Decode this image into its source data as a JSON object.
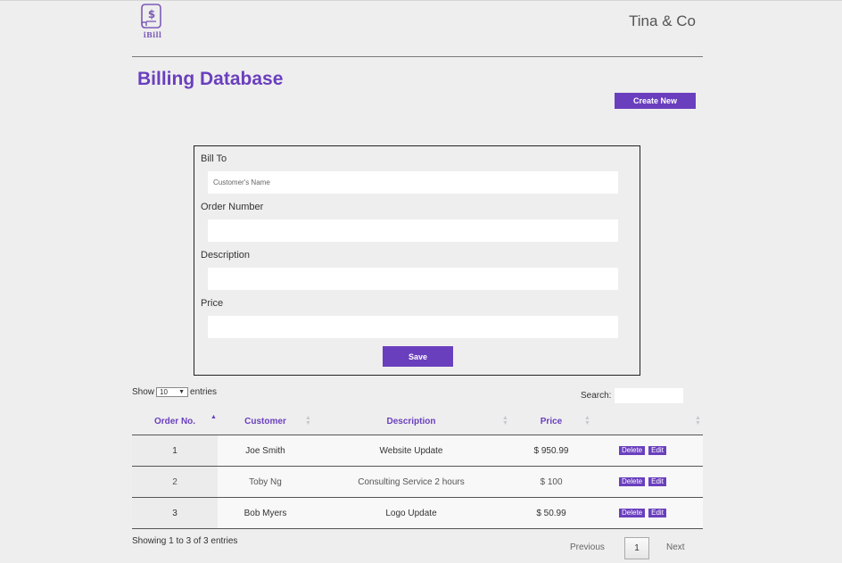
{
  "brand": {
    "logo_text": "iBill",
    "company": "Tina & Co"
  },
  "page": {
    "title": "Billing Database",
    "create_label": "Create New"
  },
  "form": {
    "bill_to_label": "Bill To",
    "bill_to_placeholder": "Customer's Name",
    "order_number_label": "Order Number",
    "description_label": "Description",
    "price_label": "Price",
    "save_label": "Save"
  },
  "table_controls": {
    "show_label": "Show",
    "entries_value": "10",
    "entries_label": "entries",
    "search_label": "Search:"
  },
  "table": {
    "columns": [
      "Order No.",
      "Customer",
      "Description",
      "Price"
    ],
    "rows": [
      {
        "order": "1",
        "customer": "Joe Smith",
        "description": "Website Update",
        "price": "$ 950.99"
      },
      {
        "order": "2",
        "customer": "Toby Ng",
        "description": "Consulting Service 2 hours",
        "price": "$ 100"
      },
      {
        "order": "3",
        "customer": "Bob Myers",
        "description": "Logo Update",
        "price": "$ 50.99"
      }
    ],
    "delete_label": "Delete",
    "edit_label": "Edit"
  },
  "footer": {
    "info": "Showing 1 to 3 of 3 entries",
    "previous": "Previous",
    "page": "1",
    "next": "Next"
  },
  "colors": {
    "accent": "#6a3fbe",
    "background": "#eeeeee"
  }
}
